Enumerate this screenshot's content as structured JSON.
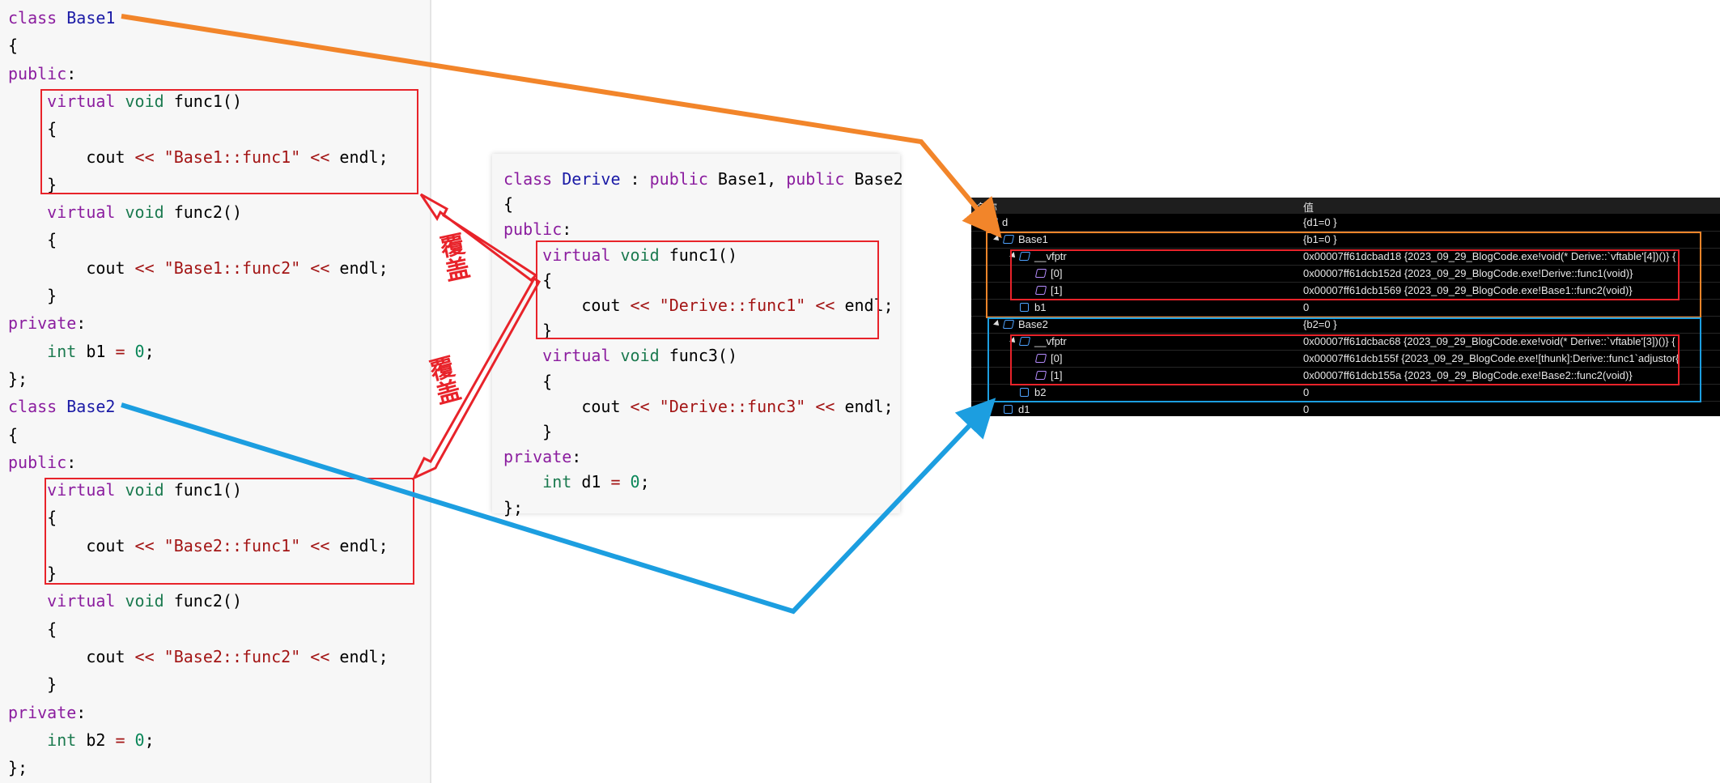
{
  "left_code": {
    "lines": [
      [
        {
          "t": "class ",
          "c": "kw"
        },
        {
          "t": "Base1",
          "c": "cls"
        }
      ],
      [
        {
          "t": "{",
          "c": ""
        }
      ],
      [
        {
          "t": "public",
          "c": "kw"
        },
        {
          "t": ":",
          "c": ""
        }
      ],
      [
        {
          "t": "    virtual ",
          "c": "kw"
        },
        {
          "t": "void ",
          "c": "kw2"
        },
        {
          "t": "func1()",
          "c": ""
        }
      ],
      [
        {
          "t": "    {",
          "c": ""
        }
      ],
      [
        {
          "t": "        cout ",
          "c": ""
        },
        {
          "t": "<< ",
          "c": "op"
        },
        {
          "t": "\"Base1::func1\"",
          "c": "str"
        },
        {
          "t": " << ",
          "c": "op"
        },
        {
          "t": "endl;",
          "c": ""
        }
      ],
      [
        {
          "t": "    }",
          "c": ""
        }
      ],
      [
        {
          "t": "    virtual ",
          "c": "kw"
        },
        {
          "t": "void ",
          "c": "kw2"
        },
        {
          "t": "func2()",
          "c": ""
        }
      ],
      [
        {
          "t": "    {",
          "c": ""
        }
      ],
      [
        {
          "t": "        cout ",
          "c": ""
        },
        {
          "t": "<< ",
          "c": "op"
        },
        {
          "t": "\"Base1::func2\"",
          "c": "str"
        },
        {
          "t": " << ",
          "c": "op"
        },
        {
          "t": "endl;",
          "c": ""
        }
      ],
      [
        {
          "t": "    }",
          "c": ""
        }
      ],
      [
        {
          "t": "private",
          "c": "kw"
        },
        {
          "t": ":",
          "c": ""
        }
      ],
      [
        {
          "t": "    int ",
          "c": "kw2"
        },
        {
          "t": "b1 ",
          "c": ""
        },
        {
          "t": "= ",
          "c": "op"
        },
        {
          "t": "0",
          "c": "num"
        },
        {
          "t": ";",
          "c": ""
        }
      ],
      [
        {
          "t": "};",
          "c": ""
        }
      ],
      [
        {
          "t": "class ",
          "c": "kw"
        },
        {
          "t": "Base2",
          "c": "cls"
        }
      ],
      [
        {
          "t": "{",
          "c": ""
        }
      ],
      [
        {
          "t": "public",
          "c": "kw"
        },
        {
          "t": ":",
          "c": ""
        }
      ],
      [
        {
          "t": "    virtual ",
          "c": "kw"
        },
        {
          "t": "void ",
          "c": "kw2"
        },
        {
          "t": "func1()",
          "c": ""
        }
      ],
      [
        {
          "t": "    {",
          "c": ""
        }
      ],
      [
        {
          "t": "        cout ",
          "c": ""
        },
        {
          "t": "<< ",
          "c": "op"
        },
        {
          "t": "\"Base2::func1\"",
          "c": "str"
        },
        {
          "t": " << ",
          "c": "op"
        },
        {
          "t": "endl;",
          "c": ""
        }
      ],
      [
        {
          "t": "    }",
          "c": ""
        }
      ],
      [
        {
          "t": "    virtual ",
          "c": "kw"
        },
        {
          "t": "void ",
          "c": "kw2"
        },
        {
          "t": "func2()",
          "c": ""
        }
      ],
      [
        {
          "t": "    {",
          "c": ""
        }
      ],
      [
        {
          "t": "        cout ",
          "c": ""
        },
        {
          "t": "<< ",
          "c": "op"
        },
        {
          "t": "\"Base2::func2\"",
          "c": "str"
        },
        {
          "t": " << ",
          "c": "op"
        },
        {
          "t": "endl;",
          "c": ""
        }
      ],
      [
        {
          "t": "    }",
          "c": ""
        }
      ],
      [
        {
          "t": "private",
          "c": "kw"
        },
        {
          "t": ":",
          "c": ""
        }
      ],
      [
        {
          "t": "    int ",
          "c": "kw2"
        },
        {
          "t": "b2 ",
          "c": ""
        },
        {
          "t": "= ",
          "c": "op"
        },
        {
          "t": "0",
          "c": "num"
        },
        {
          "t": ";",
          "c": ""
        }
      ],
      [
        {
          "t": "};",
          "c": ""
        }
      ]
    ]
  },
  "mid_code": {
    "lines": [
      [
        {
          "t": "class ",
          "c": "kw"
        },
        {
          "t": "Derive",
          "c": "cls"
        },
        {
          "t": " : ",
          "c": ""
        },
        {
          "t": "public ",
          "c": "kw"
        },
        {
          "t": "Base1, ",
          "c": ""
        },
        {
          "t": "public ",
          "c": "kw"
        },
        {
          "t": "Base2",
          "c": ""
        }
      ],
      [
        {
          "t": "{",
          "c": ""
        }
      ],
      [
        {
          "t": "public",
          "c": "kw"
        },
        {
          "t": ":",
          "c": ""
        }
      ],
      [
        {
          "t": "    virtual ",
          "c": "kw"
        },
        {
          "t": "void ",
          "c": "kw2"
        },
        {
          "t": "func1()",
          "c": ""
        }
      ],
      [
        {
          "t": "    {",
          "c": ""
        }
      ],
      [
        {
          "t": "        cout ",
          "c": ""
        },
        {
          "t": "<< ",
          "c": "op"
        },
        {
          "t": "\"Derive::func1\"",
          "c": "str"
        },
        {
          "t": " << ",
          "c": "op"
        },
        {
          "t": "endl;",
          "c": ""
        }
      ],
      [
        {
          "t": "    }",
          "c": ""
        }
      ],
      [
        {
          "t": "    virtual ",
          "c": "kw"
        },
        {
          "t": "void ",
          "c": "kw2"
        },
        {
          "t": "func3()",
          "c": ""
        }
      ],
      [
        {
          "t": "    {",
          "c": ""
        }
      ],
      [
        {
          "t": "        cout ",
          "c": ""
        },
        {
          "t": "<< ",
          "c": "op"
        },
        {
          "t": "\"Derive::func3\"",
          "c": "str"
        },
        {
          "t": " << ",
          "c": "op"
        },
        {
          "t": "endl;",
          "c": ""
        }
      ],
      [
        {
          "t": "    }",
          "c": ""
        }
      ],
      [
        {
          "t": "private",
          "c": "kw"
        },
        {
          "t": ":",
          "c": ""
        }
      ],
      [
        {
          "t": "    int ",
          "c": "kw2"
        },
        {
          "t": "d1 ",
          "c": ""
        },
        {
          "t": "= ",
          "c": "op"
        },
        {
          "t": "0",
          "c": "num"
        },
        {
          "t": ";",
          "c": ""
        }
      ],
      [
        {
          "t": "};",
          "c": ""
        }
      ]
    ]
  },
  "callouts": {
    "top": "覆盖",
    "bottom": "覆盖"
  },
  "watch": {
    "col_name": "名称",
    "col_value": "值",
    "rows": [
      {
        "name": "d",
        "value": "{d1=0 }",
        "icon": "cube",
        "tri": false
      },
      {
        "name": "Base1",
        "value": "{b1=0 }",
        "icon": "base",
        "tri": true
      },
      {
        "name": "__vfptr",
        "value": "0x00007ff61dcbad18 {2023_09_29_BlogCode.exe!void(* Derive::`vftable'[4])()} {",
        "icon": "cube",
        "tri": true
      },
      {
        "name": "[0]",
        "value": "0x00007ff61dcb152d {2023_09_29_BlogCode.exe!Derive::func1(void)}",
        "icon": "cube-purple",
        "tri": false
      },
      {
        "name": "[1]",
        "value": "0x00007ff61dcb1569 {2023_09_29_BlogCode.exe!Base1::func2(void)}",
        "icon": "cube-purple",
        "tri": false
      },
      {
        "name": "b1",
        "value": "0",
        "icon": "lock",
        "tri": false
      },
      {
        "name": "Base2",
        "value": "{b2=0 }",
        "icon": "base",
        "tri": true
      },
      {
        "name": "__vfptr",
        "value": "0x00007ff61dcbac68 {2023_09_29_BlogCode.exe!void(* Derive::`vftable'[3])()} {",
        "icon": "cube",
        "tri": true
      },
      {
        "name": "[0]",
        "value": "0x00007ff61dcb155f {2023_09_29_BlogCode.exe![thunk]:Derive::func1`adjustor{",
        "icon": "cube-purple",
        "tri": false
      },
      {
        "name": "[1]",
        "value": "0x00007ff61dcb155a {2023_09_29_BlogCode.exe!Base2::func2(void)}",
        "icon": "cube-purple",
        "tri": false
      },
      {
        "name": "b2",
        "value": "0",
        "icon": "lock",
        "tri": false
      },
      {
        "name": "d1",
        "value": "0",
        "icon": "lock",
        "tri": false
      }
    ]
  },
  "colors": {
    "orange": "#f2852a",
    "blue": "#1c9ee0",
    "red": "#e8232a"
  }
}
